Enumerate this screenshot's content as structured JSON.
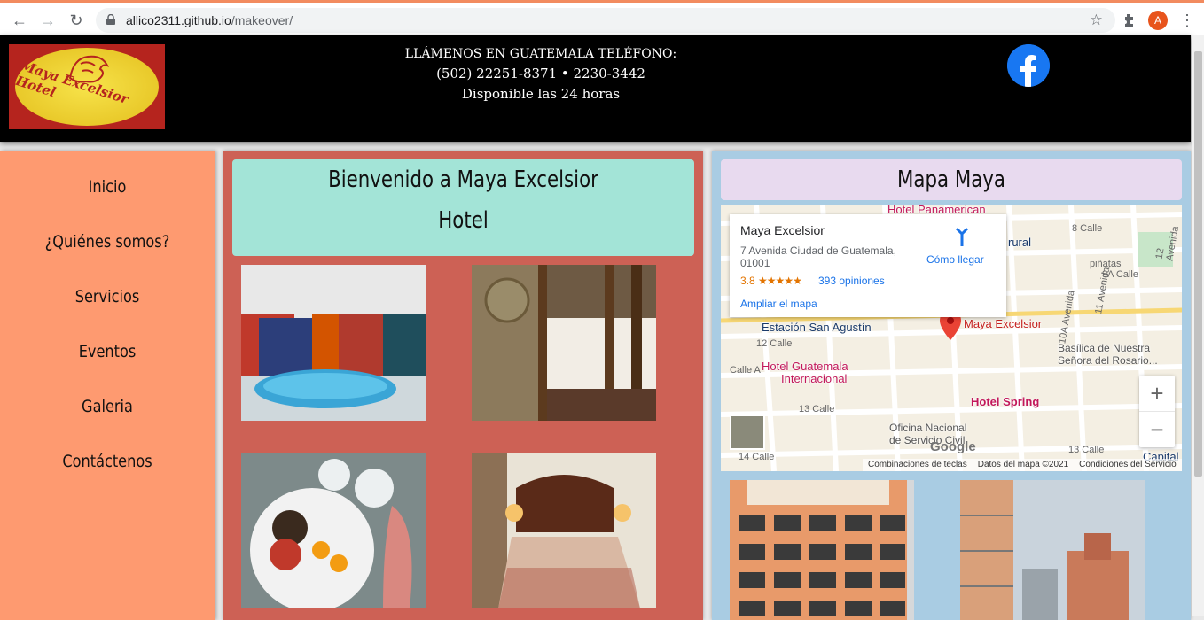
{
  "browser": {
    "url_host": "allico2311.github.io",
    "url_path": "/makeover/",
    "profile_initial": "A"
  },
  "header": {
    "logo_text": "Maya Excelsior Hotel",
    "phone_line1": "LLÁMENOS EN GUATEMALA TELÉFONO:",
    "phone_line2": "(502) 22251-8371 • 2230-3442",
    "phone_line3": "Disponible las 24 horas",
    "social_icon": "facebook-icon"
  },
  "sidebar": {
    "items": [
      {
        "label": "Inicio"
      },
      {
        "label": "¿Quiénes somos?"
      },
      {
        "label": "Servicios"
      },
      {
        "label": "Eventos"
      },
      {
        "label": "Galeria"
      },
      {
        "label": "Contáctenos"
      }
    ]
  },
  "main": {
    "welcome_line1": "Bienvenido a Maya Excelsior",
    "welcome_line2": "Hotel",
    "photos": [
      "pool",
      "lobby",
      "breakfast",
      "bedroom"
    ]
  },
  "map_panel": {
    "title": "Mapa Maya",
    "card": {
      "name": "Maya Excelsior",
      "address": "7 Avenida Ciudad de Guatemala, 01001",
      "rating": "3.8",
      "stars": "★★★★★",
      "reviews": "393 opiniones",
      "enlarge": "Ampliar el mapa",
      "directions": "Cómo llegar"
    },
    "labels": {
      "maya": "Maya Excelsior",
      "panamerican": "Hotel Panamerican",
      "guatemala_intl_1": "Hotel Guatemala",
      "guatemala_intl_2": "Internacional",
      "spring": "Hotel Spring",
      "san_agustin": "Estación San Agustín",
      "basilica_1": "Basílica de Nuestra",
      "basilica_2": "Señora del Rosario...",
      "oficina_1": "Oficina Nacional",
      "oficina_2": "de Servicio Civil",
      "rural": "rural",
      "capital": "Capital",
      "calle_8": "8 Calle",
      "calle_9a": "9A Calle",
      "calle_12": "12 Calle",
      "calle_13": "13 Calle",
      "calle_13b": "13 Calle",
      "calle_14": "14 Calle",
      "calle_a": "Calle A",
      "av_10a": "10A Avenida",
      "av_11": "11 Avenida",
      "av_12": "12 Avenida",
      "pinatas": "piñatas",
      "google": "Google"
    },
    "footer": [
      "Combinaciones de teclas",
      "Datos del mapa ©2021",
      "Condiciones del Servicio"
    ],
    "zoom_in": "+",
    "zoom_out": "−"
  }
}
